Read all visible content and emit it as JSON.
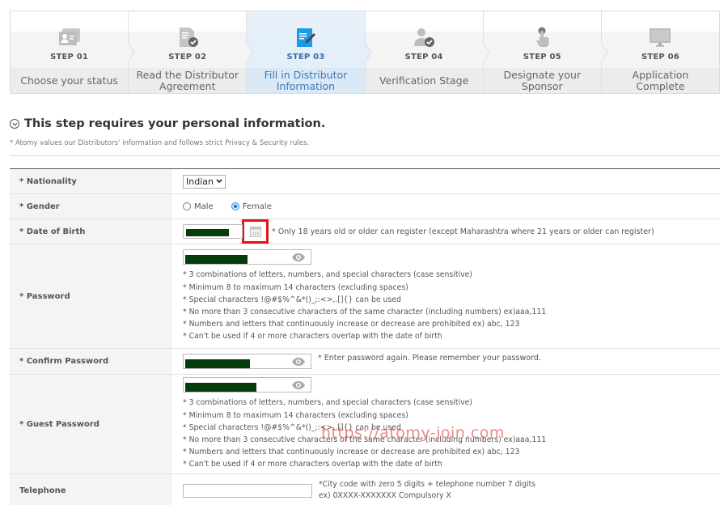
{
  "stepper": {
    "active_index": 2,
    "steps": [
      {
        "number": "STEP 01",
        "label": "Choose your status",
        "icon": "id-card-icon"
      },
      {
        "number": "STEP 02",
        "label": "Read the Distributor Agreement",
        "icon": "document-check-icon"
      },
      {
        "number": "STEP 03",
        "label": "Fill in Distributor Information",
        "icon": "edit-form-icon"
      },
      {
        "number": "STEP 04",
        "label": "Verification Stage",
        "icon": "user-check-icon"
      },
      {
        "number": "STEP 05",
        "label": "Designate your Sponsor",
        "icon": "finger-tap-icon"
      },
      {
        "number": "STEP 06",
        "label": "Application Complete",
        "icon": "monitor-icon"
      }
    ]
  },
  "section": {
    "title": "This step requires your personal information.",
    "note": "* Atomy values our Distributors' information and follows strict Privacy & Security rules."
  },
  "form": {
    "nationality": {
      "label": "* Nationality",
      "value": "Indian"
    },
    "gender": {
      "label": "* Gender",
      "options": [
        "Male",
        "Female"
      ],
      "selected": "Female"
    },
    "dob": {
      "label": "* Date of Birth",
      "note": "* Only 18 years old or older can register (except Maharashtra where 21 years or older can register)"
    },
    "password": {
      "label": "* Password",
      "rules": [
        "* 3 combinations of letters, numbers, and special characters (case sensitive)",
        "* Minimum 8 to maximum 14 characters (excluding spaces)",
        "* Special characters !@#$%^&*()_;:<>,.[]{} can be used",
        "* No more than 3 consecutive characters of the same character (including numbers) ex)aaa,111",
        "* Numbers and letters that continuously increase or decrease are prohibited ex) abc, 123",
        "* Can't be used if 4 or more characters overlap with the date of birth"
      ]
    },
    "confirm_password": {
      "label": "* Confirm Password",
      "note": "* Enter password again. Please remember your password."
    },
    "guest_password": {
      "label": "* Guest Password",
      "rules": [
        "* 3 combinations of letters, numbers, and special characters (case sensitive)",
        "* Minimum 8 to maximum 14 characters (excluding spaces)",
        "* Special characters !@#$%^&*()_;:<>,.[]{} can be used",
        "* No more than 3 consecutive characters of the same character (including numbers) ex)aaa,111",
        "* Numbers and letters that continuously increase or decrease are prohibited ex) abc, 123",
        "* Can't be used if 4 or more characters overlap with the date of birth"
      ]
    },
    "telephone": {
      "label": "Telephone",
      "value": "",
      "notes": [
        "*City code with zero 5 digits + telephone number 7 digits",
        "ex) 0XXXX-XXXXXXX Compulsory X"
      ]
    }
  },
  "watermark": "https://atomy-join.com",
  "colors": {
    "redacted_fill": "#063c0c",
    "highlight_box": "#e8141b",
    "active_step_bg": "#e4eff9",
    "active_step_text": "#3a78b5"
  }
}
